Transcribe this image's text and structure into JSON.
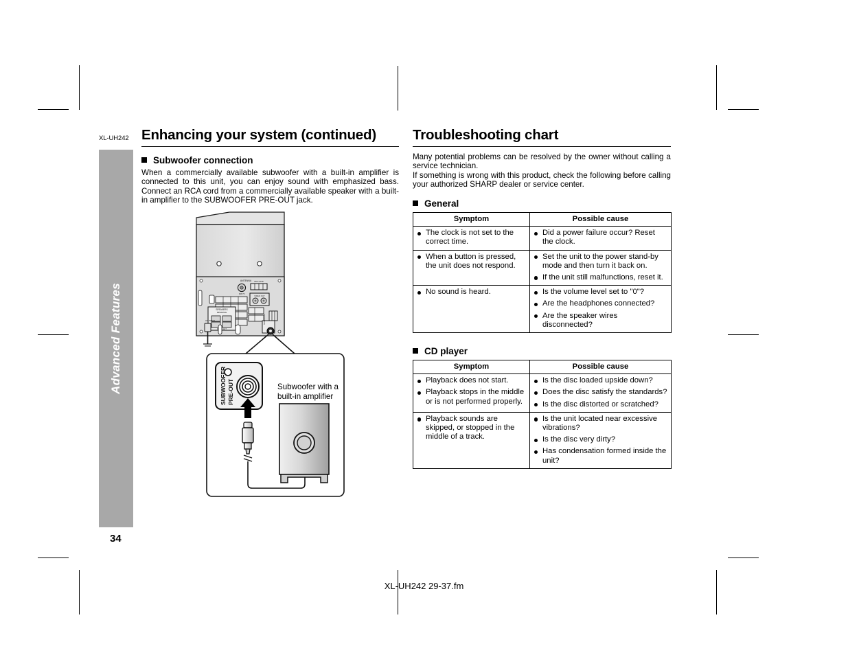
{
  "document": {
    "model_label": "XL-UH242",
    "page_number": "34",
    "footer_filename": "XL-UH242 29-37.fm",
    "sidebar_tab_label": "Advanced Features",
    "sidebar_color": "#a8a8a8"
  },
  "left_column": {
    "title": "Enhancing your system (continued)",
    "subsection_title": "Subwoofer connection",
    "body": "When a commercially available subwoofer with a built-in amplifier is connected to this unit, you can enjoy sound with emphasized bass. Connect an RCA cord from a commercially available speaker with a built-in amplifier to the SUBWOOFER PRE-OUT jack.",
    "figure": {
      "jack_label_line1": "SUBWOOFER",
      "jack_label_line2": "PRE-OUT",
      "callout_label_line1": "Subwoofer with a",
      "callout_label_line2": "built-in amplifier",
      "rear_panel_labels": {
        "ac_input": "AC INPUT",
        "speakers": "SPEAKERS",
        "antenna": "ANTENNA",
        "am_loop": "AM LOOP",
        "fm_75": "FM 75",
        "subwoofer": "SUBWOOFER PRE-OUT"
      }
    }
  },
  "right_column": {
    "title": "Troubleshooting chart",
    "intro_paragraph_1": "Many potential problems can be resolved by the owner without calling a service technician.",
    "intro_paragraph_2": "If something is wrong with this product, check the following before calling your authorized SHARP dealer or service center.",
    "sections": [
      {
        "heading": "General",
        "columns": [
          "Symptom",
          "Possible cause"
        ],
        "rows": [
          {
            "symptom": [
              "The clock is not set to the correct time."
            ],
            "cause": [
              "Did a power failure occur? Reset the clock."
            ]
          },
          {
            "symptom": [
              "When a button is pressed, the unit does not respond."
            ],
            "cause": [
              "Set the unit to the power stand-by mode and then turn it back on.",
              "If the unit still malfunctions, reset it."
            ]
          },
          {
            "symptom": [
              "No sound is heard."
            ],
            "cause": [
              "Is the volume level set to \"0\"?",
              "Are the headphones connected?",
              "Are the speaker wires disconnected?"
            ]
          }
        ]
      },
      {
        "heading": "CD player",
        "columns": [
          "Symptom",
          "Possible cause"
        ],
        "rows": [
          {
            "symptom": [
              "Playback does not start.",
              "Playback stops in the middle or is not performed properly."
            ],
            "cause": [
              "Is the disc loaded upside down?",
              "Does the disc satisfy the standards?",
              "Is the disc distorted or scratched?"
            ]
          },
          {
            "symptom": [
              "Playback sounds are skipped, or stopped in the middle of a track."
            ],
            "cause": [
              "Is the unit located near excessive vibrations?",
              "Is the disc very dirty?",
              "Has condensation formed inside the unit?"
            ]
          }
        ]
      }
    ]
  }
}
